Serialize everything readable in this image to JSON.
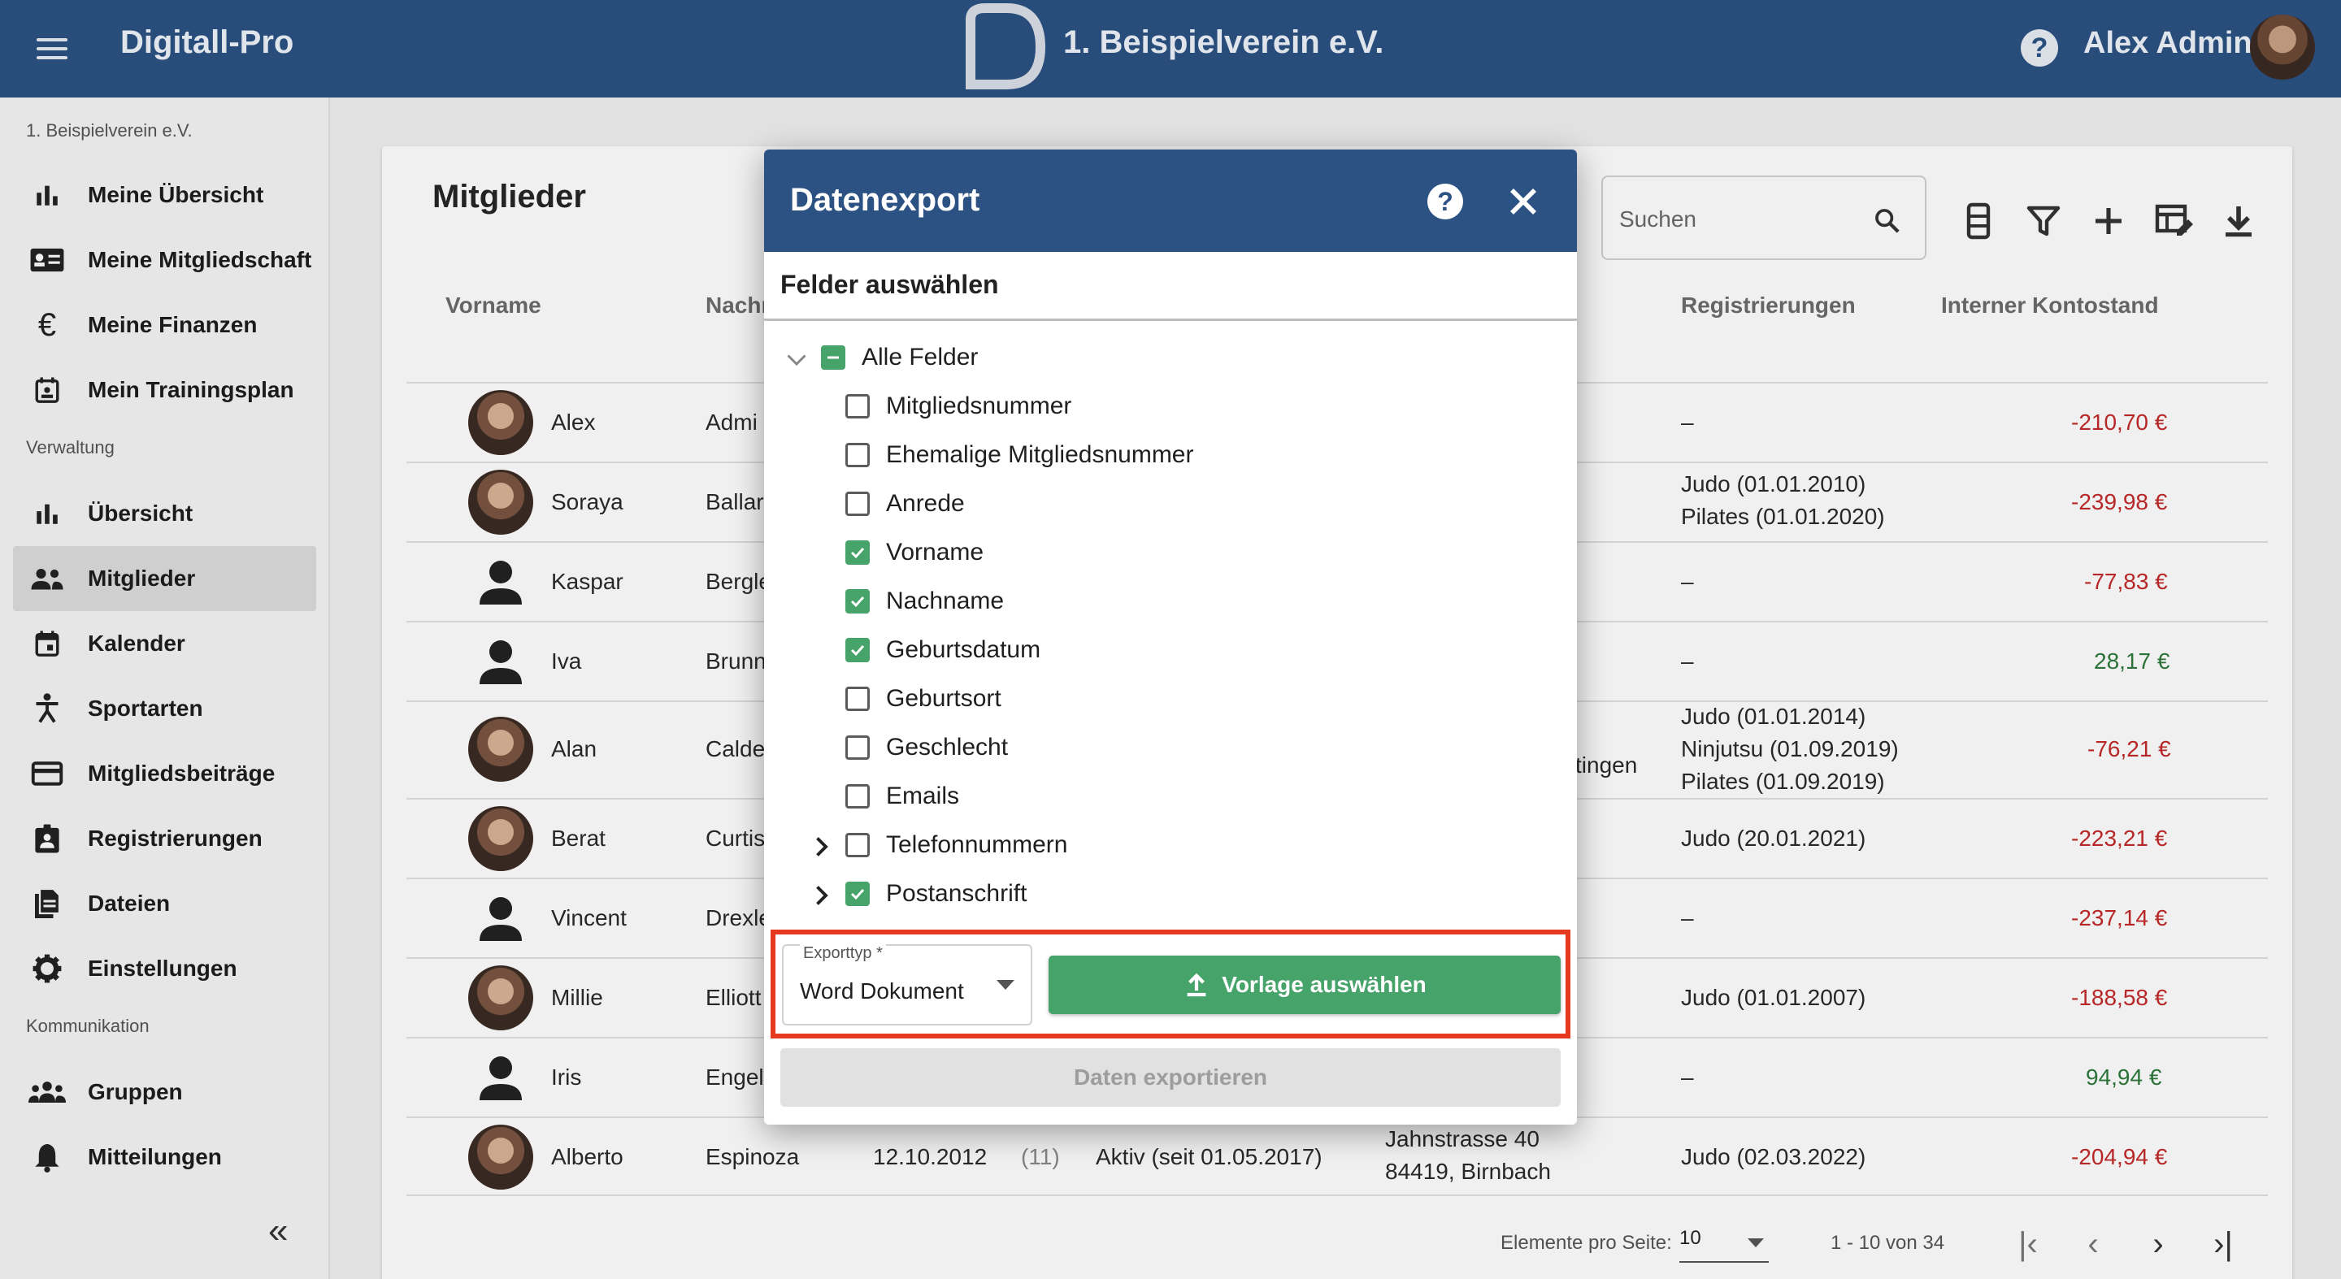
{
  "topbar": {
    "app_title": "Digitall-Pro",
    "club_name": "1. Beispielverein e.V.",
    "user_name": "Alex Admin"
  },
  "sidebar": {
    "club_label": "1. Beispielverein e.V.",
    "sections": {
      "verwaltung": "Verwaltung",
      "kommunikation": "Kommunikation"
    },
    "personal_items": [
      {
        "label": "Meine Übersicht",
        "icon": "bar-chart-icon"
      },
      {
        "label": "Meine Mitgliedschaft",
        "icon": "id-card-icon"
      },
      {
        "label": "Meine Finanzen",
        "icon": "euro-icon"
      },
      {
        "label": "Mein Trainingsplan",
        "icon": "calendar-person-icon"
      }
    ],
    "admin_items": [
      {
        "label": "Übersicht",
        "icon": "bar-chart-icon"
      },
      {
        "label": "Mitglieder",
        "icon": "people-icon",
        "active": true
      },
      {
        "label": "Kalender",
        "icon": "calendar-icon"
      },
      {
        "label": "Sportarten",
        "icon": "sport-icon"
      },
      {
        "label": "Mitgliedsbeiträge",
        "icon": "credit-card-icon"
      },
      {
        "label": "Registrierungen",
        "icon": "badge-icon"
      },
      {
        "label": "Dateien",
        "icon": "files-icon"
      },
      {
        "label": "Einstellungen",
        "icon": "gear-icon"
      }
    ],
    "comm_items": [
      {
        "label": "Gruppen",
        "icon": "groups-icon"
      },
      {
        "label": "Mitteilungen",
        "icon": "bell-icon"
      }
    ],
    "collapse": "«"
  },
  "main": {
    "title": "Mitglieder",
    "search_placeholder": "Suchen",
    "columns": {
      "vorname": "Vorname",
      "nachname": "Nachn",
      "registrierungen": "Registrierungen",
      "kontostand": "Interner Kontostand"
    },
    "rows": [
      {
        "vorname": "Alex",
        "nachname": "Admi",
        "reg": [
          "–"
        ],
        "konto": "-210,70 €",
        "konto_color": "red",
        "avatar": "photo"
      },
      {
        "vorname": "Soraya",
        "nachname": "Ballar",
        "reg": [
          "Judo (01.01.2010)",
          "Pilates (01.01.2020)"
        ],
        "konto": "-239,98 €",
        "konto_color": "red",
        "avatar": "photo"
      },
      {
        "vorname": "Kaspar",
        "nachname": "Bergle",
        "reg": [
          "–"
        ],
        "konto": "-77,83 €",
        "konto_color": "red",
        "avatar": "person"
      },
      {
        "vorname": "Iva",
        "nachname": "Brunn",
        "reg": [
          "–"
        ],
        "konto": "28,17 €",
        "konto_color": "green",
        "avatar": "person"
      },
      {
        "vorname": "Alan",
        "nachname": "Calde",
        "extra": "tingen",
        "reg": [
          "Judo (01.01.2014)",
          "Ninjutsu (01.09.2019)",
          "Pilates (01.09.2019)"
        ],
        "konto": "-76,21 €",
        "konto_color": "red",
        "avatar": "photo"
      },
      {
        "vorname": "Berat",
        "nachname": "Curtis",
        "reg": [
          "Judo (20.01.2021)"
        ],
        "konto": "-223,21 €",
        "konto_color": "red",
        "avatar": "photo"
      },
      {
        "vorname": "Vincent",
        "nachname": "Drexle",
        "reg": [
          "–"
        ],
        "konto": "-237,14 €",
        "konto_color": "red",
        "avatar": "person"
      },
      {
        "vorname": "Millie",
        "nachname": "Elliott",
        "reg": [
          "Judo (01.01.2007)"
        ],
        "konto": "-188,58 €",
        "konto_color": "red",
        "avatar": "photo"
      },
      {
        "vorname": "Iris",
        "nachname": "Engell",
        "reg": [
          "–"
        ],
        "konto": "94,94 €",
        "konto_color": "green",
        "avatar": "person"
      },
      {
        "vorname": "Alberto",
        "nachname": "Espinoza",
        "birth": "12.10.2012",
        "age": "(11)",
        "status": "Aktiv (seit 01.05.2017)",
        "address": [
          "Jahnstrasse 40",
          "84419, Birnbach"
        ],
        "reg": [
          "Judo (02.03.2022)"
        ],
        "konto": "-204,94 €",
        "konto_color": "red",
        "avatar": "photo"
      }
    ],
    "pager": {
      "label": "Elemente pro Seite:",
      "size": "10",
      "range": "1 - 10 von 34"
    }
  },
  "dialog": {
    "title": "Datenexport",
    "subtitle": "Felder auswählen",
    "all_fields": "Alle Felder",
    "fields": [
      {
        "label": "Mitgliedsnummer",
        "checked": false
      },
      {
        "label": "Ehemalige Mitgliedsnummer",
        "checked": false
      },
      {
        "label": "Anrede",
        "checked": false
      },
      {
        "label": "Vorname",
        "checked": true
      },
      {
        "label": "Nachname",
        "checked": true
      },
      {
        "label": "Geburtsdatum",
        "checked": true
      },
      {
        "label": "Geburtsort",
        "checked": false
      },
      {
        "label": "Geschlecht",
        "checked": false
      },
      {
        "label": "Emails",
        "checked": false
      },
      {
        "label": "Telefonnummern",
        "checked": false,
        "expandable": true
      },
      {
        "label": "Postanschrift",
        "checked": true,
        "expandable": true
      }
    ],
    "export_type_label": "Exporttyp *",
    "export_type_value": "Word Dokument",
    "template_button": "Vorlage auswählen",
    "export_button": "Daten exportieren"
  },
  "colors": {
    "header": "#2c5283",
    "accent_green": "#46a36a",
    "negative": "#c32a2a",
    "positive": "#2d7a3b",
    "highlight": "#e53a1f"
  }
}
